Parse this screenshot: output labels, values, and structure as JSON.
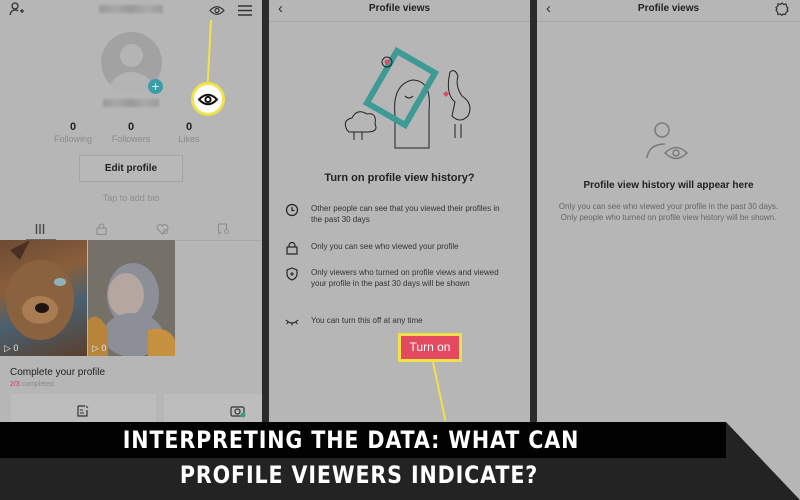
{
  "panel_profile": {
    "stats": [
      {
        "value": "0",
        "label": "Following"
      },
      {
        "value": "0",
        "label": "Followers"
      },
      {
        "value": "0",
        "label": "Likes"
      }
    ],
    "edit_profile_label": "Edit profile",
    "bio_placeholder": "Tap to add bio",
    "tabs": [
      "videos-grid",
      "private",
      "liked",
      "favorites"
    ],
    "videos": [
      {
        "views": "0",
        "subject": "brown plush toy"
      },
      {
        "views": "0",
        "subject": "gray donkey plush toy"
      }
    ],
    "complete_profile": {
      "title": "Complete your profile",
      "progress": "2/3",
      "progress_suffix": "completed"
    },
    "highlight_color": "#f1e34a"
  },
  "panel_prompt": {
    "header_title": "Profile views",
    "heading": "Turn on profile view history?",
    "bullets": [
      {
        "icon": "clock-icon",
        "text": "Other people can see that you viewed their profiles in the past 30 days"
      },
      {
        "icon": "lock-icon",
        "text": "Only you can see who viewed your profile"
      },
      {
        "icon": "shield-icon",
        "text": "Only viewers who turned on profile views and viewed your profile in the past 30 days will be shown"
      },
      {
        "icon": "closed-eye-icon",
        "text": "You can turn this off at any time"
      }
    ],
    "turn_on_label": "Turn on",
    "accent_color": "#e34a60"
  },
  "panel_empty": {
    "header_title": "Profile views",
    "heading": "Profile view history will appear here",
    "description": "Only you can see who viewed your profile in the past 30 days. Only people who turned on profile view history will be shown."
  },
  "banner": {
    "line1": "INTERPRETING THE DATA: WHAT CAN",
    "line2": "PROFILE VIEWERS INDICATE?"
  }
}
